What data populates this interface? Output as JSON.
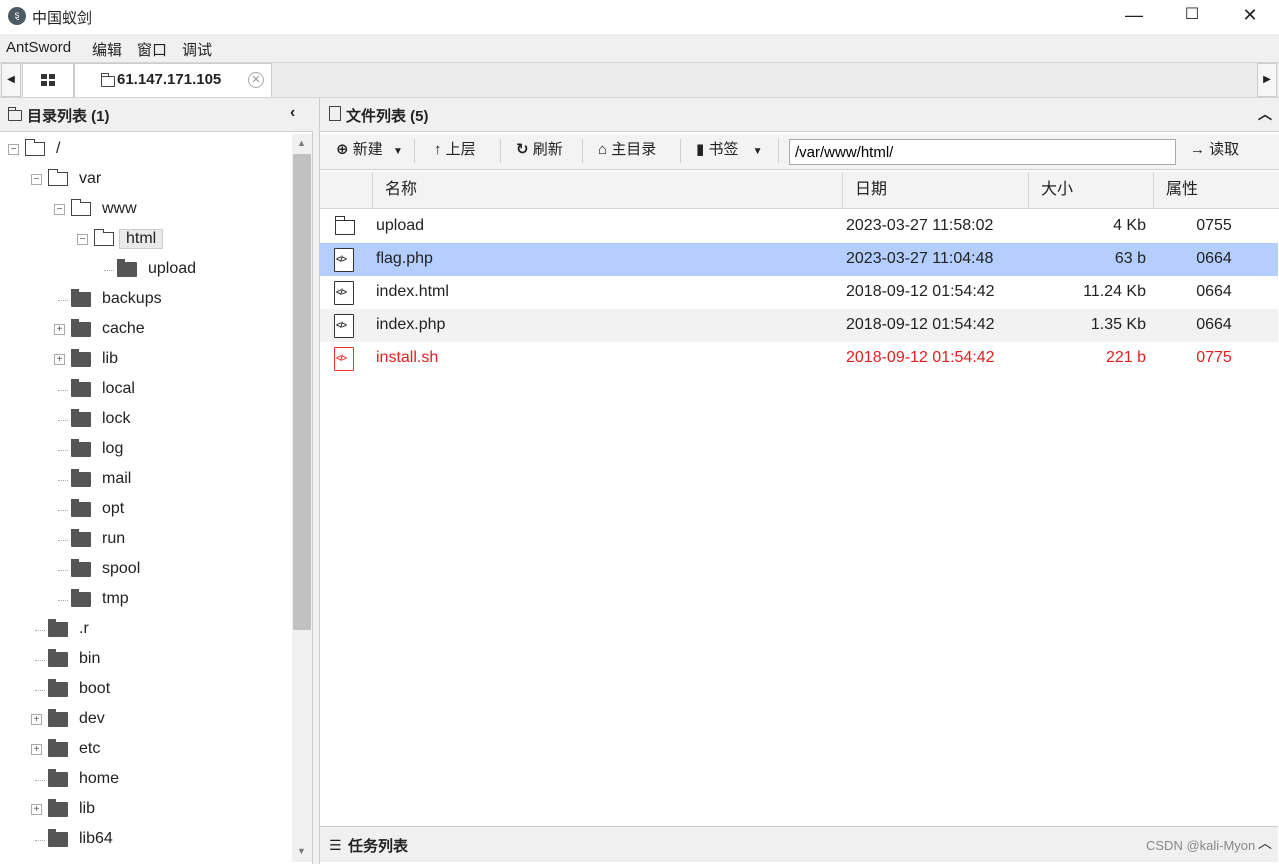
{
  "window": {
    "title": "中国蚁剑",
    "minimize": "—",
    "maximize": "☐",
    "close": "✕"
  },
  "menu": [
    "AntSword",
    "编辑",
    "窗口",
    "调试"
  ],
  "tabs": {
    "active_label": "61.147.171.105"
  },
  "left_panel": {
    "header": "目录列表 (1)",
    "tree": [
      {
        "label": "/",
        "depth": 0,
        "toggle": "minus",
        "icon": "folder-open"
      },
      {
        "label": "var",
        "depth": 1,
        "toggle": "minus",
        "icon": "folder-open"
      },
      {
        "label": "www",
        "depth": 2,
        "toggle": "minus",
        "icon": "folder-open"
      },
      {
        "label": "html",
        "depth": 3,
        "toggle": "minus",
        "icon": "folder-open",
        "selected": true
      },
      {
        "label": "upload",
        "depth": 4,
        "toggle": "none",
        "icon": "folder"
      },
      {
        "label": "backups",
        "depth": 2,
        "toggle": "none",
        "icon": "folder"
      },
      {
        "label": "cache",
        "depth": 2,
        "toggle": "plus",
        "icon": "folder"
      },
      {
        "label": "lib",
        "depth": 2,
        "toggle": "plus",
        "icon": "folder"
      },
      {
        "label": "local",
        "depth": 2,
        "toggle": "none",
        "icon": "folder"
      },
      {
        "label": "lock",
        "depth": 2,
        "toggle": "none",
        "icon": "folder"
      },
      {
        "label": "log",
        "depth": 2,
        "toggle": "none",
        "icon": "folder"
      },
      {
        "label": "mail",
        "depth": 2,
        "toggle": "none",
        "icon": "folder"
      },
      {
        "label": "opt",
        "depth": 2,
        "toggle": "none",
        "icon": "folder"
      },
      {
        "label": "run",
        "depth": 2,
        "toggle": "none",
        "icon": "folder"
      },
      {
        "label": "spool",
        "depth": 2,
        "toggle": "none",
        "icon": "folder"
      },
      {
        "label": "tmp",
        "depth": 2,
        "toggle": "none",
        "icon": "folder"
      },
      {
        "label": ".r",
        "depth": 1,
        "toggle": "none",
        "icon": "folder"
      },
      {
        "label": "bin",
        "depth": 1,
        "toggle": "none",
        "icon": "folder"
      },
      {
        "label": "boot",
        "depth": 1,
        "toggle": "none",
        "icon": "folder"
      },
      {
        "label": "dev",
        "depth": 1,
        "toggle": "plus",
        "icon": "folder"
      },
      {
        "label": "etc",
        "depth": 1,
        "toggle": "plus",
        "icon": "folder"
      },
      {
        "label": "home",
        "depth": 1,
        "toggle": "none",
        "icon": "folder"
      },
      {
        "label": "lib",
        "depth": 1,
        "toggle": "plus",
        "icon": "folder"
      },
      {
        "label": "lib64",
        "depth": 1,
        "toggle": "none",
        "icon": "folder"
      }
    ]
  },
  "right_panel": {
    "header": "文件列表 (5)",
    "toolbar": {
      "new_label": "新建",
      "up_label": "上层",
      "refresh_label": "刷新",
      "home_label": "主目录",
      "bookmark_label": "书签",
      "path_value": "/var/www/html/",
      "read_label": "读取"
    },
    "columns": [
      "名称",
      "日期",
      "大小",
      "属性"
    ],
    "files": [
      {
        "name": "upload",
        "date": "2023-03-27 11:58:02",
        "size": "4 Kb",
        "attr": "0755",
        "type": "dir",
        "highlight": false,
        "red": false
      },
      {
        "name": "flag.php",
        "date": "2023-03-27 11:04:48",
        "size": "63 b",
        "attr": "0664",
        "type": "file",
        "highlight": true,
        "red": false
      },
      {
        "name": "index.html",
        "date": "2018-09-12 01:54:42",
        "size": "11.24 Kb",
        "attr": "0664",
        "type": "file",
        "highlight": false,
        "red": false
      },
      {
        "name": "index.php",
        "date": "2018-09-12 01:54:42",
        "size": "1.35 Kb",
        "attr": "0664",
        "type": "file",
        "highlight": false,
        "red": false
      },
      {
        "name": "install.sh",
        "date": "2018-09-12 01:54:42",
        "size": "221 b",
        "attr": "0775",
        "type": "file",
        "highlight": false,
        "red": true
      }
    ],
    "task_header": "任务列表"
  },
  "watermark": "CSDN @kali-Myon",
  "colors": {
    "selected_row": "#b3ceff",
    "alt_row": "#f2f2f2",
    "red_text": "#e02020"
  }
}
